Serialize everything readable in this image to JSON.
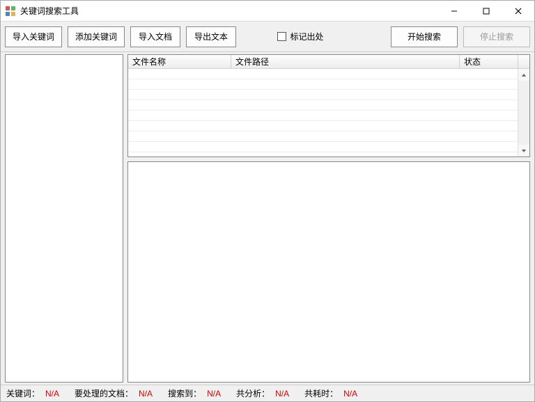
{
  "window": {
    "title": "关键词搜索工具"
  },
  "toolbar": {
    "import_keywords": "导入关键词",
    "add_keywords": "添加关键词",
    "import_docs": "导入文档",
    "export_text": "导出文本",
    "mark_source": "标记出处",
    "start_search": "开始搜索",
    "stop_search": "停止搜索"
  },
  "columns": {
    "file_name": "文件名称",
    "file_path": "文件路径",
    "status": "状态"
  },
  "status": {
    "keywords_label": "关键词：",
    "keywords_value": "N/A",
    "docs_label": "要处理的文档：",
    "docs_value": "N/A",
    "found_label": "搜索到：",
    "found_value": "N/A",
    "analyzed_label": "共分析：",
    "analyzed_value": "N/A",
    "elapsed_label": "共耗时：",
    "elapsed_value": "N/A"
  }
}
